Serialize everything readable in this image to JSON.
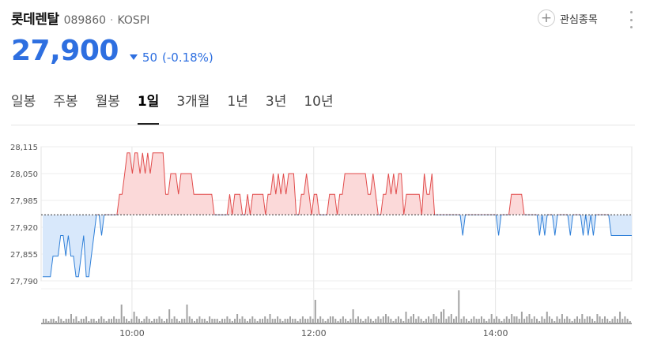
{
  "stock": {
    "name": "롯데렌탈",
    "code": "089860",
    "market": "KOSPI"
  },
  "watchlist": {
    "label": "관심종목"
  },
  "price": {
    "current": "27,900",
    "change": "50",
    "change_pct": "(-0.18%)",
    "direction": "down",
    "color": "#2e6fe0"
  },
  "tabs": [
    {
      "label": "일봉",
      "active": false
    },
    {
      "label": "주봉",
      "active": false
    },
    {
      "label": "월봉",
      "active": false
    },
    {
      "label": "1일",
      "active": true
    },
    {
      "label": "3개월",
      "active": false
    },
    {
      "label": "1년",
      "active": false
    },
    {
      "label": "3년",
      "active": false
    },
    {
      "label": "10년",
      "active": false
    }
  ],
  "chart_data": {
    "type": "line",
    "title": "",
    "xlabel": "",
    "ylabel": "",
    "x_ticks": [
      "10:00",
      "12:00",
      "14:00"
    ],
    "y_ticks": [
      "28,115",
      "28,050",
      "27,985",
      "27,920",
      "27,855",
      "27,790"
    ],
    "ylim": [
      27790,
      28115
    ],
    "xlim": [
      "09:00",
      "15:30"
    ],
    "baseline": 27950,
    "above_color": "#e14b4b",
    "below_color": "#2e7fd8",
    "series": [
      {
        "values": [
          27800,
          27800,
          27800,
          27800,
          27850,
          27850,
          27850,
          27900,
          27900,
          27850,
          27900,
          27850,
          27850,
          27800,
          27800,
          27850,
          27900,
          27800,
          27800,
          27850,
          27900,
          27950,
          27950,
          27900,
          27950,
          27950,
          27950,
          27950,
          27950,
          27950,
          28000,
          28000,
          28050,
          28100,
          28100,
          28050,
          28100,
          28100,
          28050,
          28100,
          28050,
          28100,
          28050,
          28100,
          28100,
          28100,
          28100,
          28100,
          28000,
          28000,
          28050,
          28050,
          28050,
          28000,
          28050,
          28050,
          28050,
          28050,
          28050,
          28000,
          28000,
          28000,
          28000,
          28000,
          28000,
          28000,
          28000,
          27950,
          27950,
          27950,
          27950,
          27950,
          27950,
          28000,
          27950,
          28000,
          28000,
          28000,
          27950,
          27950,
          28000,
          27950,
          28000,
          28000,
          28000,
          28000,
          28000,
          27950,
          28000,
          28000,
          28050,
          28000,
          28050,
          28000,
          28050,
          28000,
          28050,
          28050,
          28050,
          27950,
          27950,
          28000,
          28000,
          28050,
          28000,
          27950,
          28000,
          28000,
          27950,
          27950,
          27950,
          27950,
          28000,
          28000,
          28000,
          27950,
          28000,
          28000,
          28050,
          28050,
          28050,
          28050,
          28050,
          28050,
          28050,
          28050,
          28050,
          28000,
          28000,
          28050,
          28000,
          27950,
          27950,
          28000,
          28000,
          28050,
          28000,
          28050,
          28000,
          28050,
          28050,
          27950,
          28000,
          28000,
          28000,
          28000,
          28000,
          28000,
          27950,
          28050,
          28000,
          28000,
          28050,
          27950,
          27950,
          27950,
          27950,
          27950,
          27950,
          27950,
          27950,
          27950,
          27950,
          27950,
          27900,
          27950,
          27950,
          27950,
          27950,
          27950,
          27950,
          27950,
          27950,
          27950,
          27950,
          27950,
          27950,
          27950,
          27900,
          27950,
          27950,
          27950,
          27950,
          28000,
          28000,
          28000,
          28000,
          28000,
          27950,
          27950,
          27950,
          27950,
          27950,
          27950,
          27900,
          27950,
          27900,
          27950,
          27950,
          27950,
          27900,
          27950,
          27950,
          27950,
          27950,
          27950,
          27900,
          27950,
          27950,
          27950,
          27950,
          27900,
          27950,
          27900,
          27950,
          27900,
          27950,
          27950,
          27950,
          27950,
          27950,
          27950,
          27900,
          27900,
          27900,
          27900,
          27900,
          27900,
          27900,
          27900,
          27900
        ],
        "volume": [
          2,
          2,
          1,
          2,
          2,
          1,
          3,
          2,
          1,
          2,
          2,
          4,
          2,
          3,
          1,
          2,
          2,
          3,
          1,
          2,
          2,
          1,
          2,
          3,
          2,
          1,
          2,
          2,
          3,
          2,
          2,
          8,
          3,
          2,
          1,
          2,
          5,
          3,
          2,
          1,
          2,
          3,
          2,
          1,
          2,
          2,
          3,
          2,
          1,
          2,
          6,
          2,
          3,
          2,
          1,
          2,
          2,
          8,
          3,
          2,
          1,
          2,
          3,
          2,
          2,
          1,
          3,
          2,
          2,
          2,
          1,
          2,
          2,
          3,
          2,
          1,
          2,
          4,
          2,
          3,
          2,
          1,
          2,
          3,
          2,
          1,
          2,
          2,
          3,
          2,
          4,
          2,
          2,
          3,
          2,
          1,
          2,
          2,
          3,
          2,
          2,
          1,
          2,
          3,
          2,
          2,
          3,
          2,
          10,
          2,
          3,
          2,
          1,
          2,
          3,
          3,
          2,
          1,
          2,
          3,
          2,
          1,
          2,
          6,
          2,
          3,
          2,
          1,
          2,
          3,
          2,
          1,
          2,
          3,
          2,
          3,
          4,
          3,
          2,
          1,
          2,
          3,
          2,
          1,
          5,
          2,
          3,
          4,
          2,
          3,
          2,
          1,
          2,
          3,
          2,
          4,
          3,
          2,
          5,
          6,
          2,
          3,
          4,
          2,
          3,
          14,
          2,
          3,
          2,
          1,
          2,
          3,
          2,
          2,
          3,
          2,
          1,
          2,
          4,
          2,
          3,
          2,
          1,
          2,
          3,
          2,
          4,
          3,
          3,
          2,
          5,
          2,
          3,
          4,
          2,
          3,
          2,
          1,
          3,
          2,
          5,
          3,
          2,
          1,
          3,
          2,
          4,
          2,
          3,
          2,
          1,
          2,
          3,
          2,
          4,
          2,
          3,
          3,
          2,
          1,
          4,
          3,
          2,
          3,
          2,
          1,
          2,
          3,
          2,
          5,
          2,
          3,
          2,
          1
        ]
      }
    ],
    "grid": true
  }
}
